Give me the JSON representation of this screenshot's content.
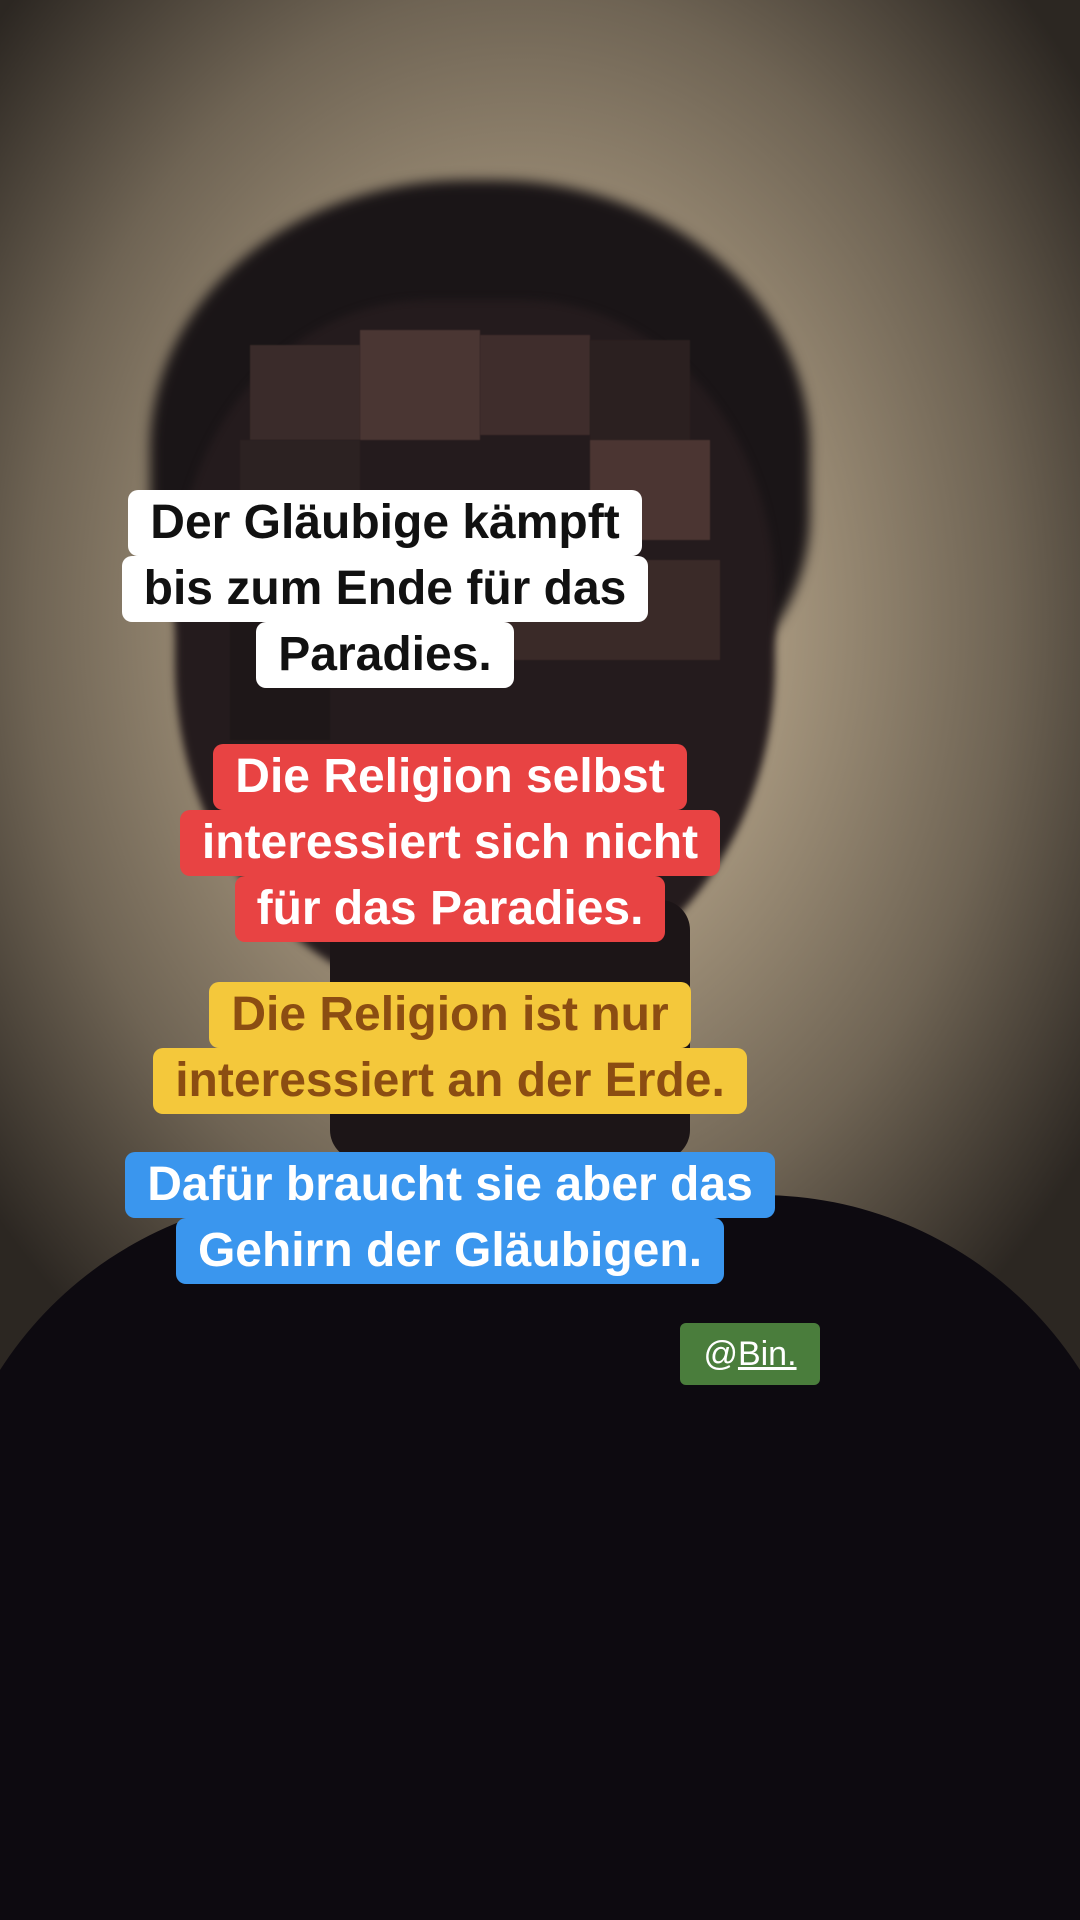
{
  "captions": [
    {
      "lines": [
        "Der Gläubige kämpft",
        "bis zum Ende für das",
        "Paradies."
      ],
      "bg": "#ffffff",
      "fg": "#111111"
    },
    {
      "lines": [
        "Die Religion selbst",
        "interessiert sich nicht",
        "für das Paradies."
      ],
      "bg": "#e84343",
      "fg": "#ffffff"
    },
    {
      "lines": [
        "Die Religion ist nur",
        "interessiert an der Erde."
      ],
      "bg": "#f4c83b",
      "fg": "#8b4d12"
    },
    {
      "lines": [
        "Dafür braucht sie aber das",
        "Gehirn der Gläubigen."
      ],
      "bg": "#3a96ee",
      "fg": "#ffffff"
    }
  ],
  "mention": {
    "at": "@",
    "handle": "Bin."
  },
  "colors": {
    "mention_bg": "#4a7d3c"
  }
}
